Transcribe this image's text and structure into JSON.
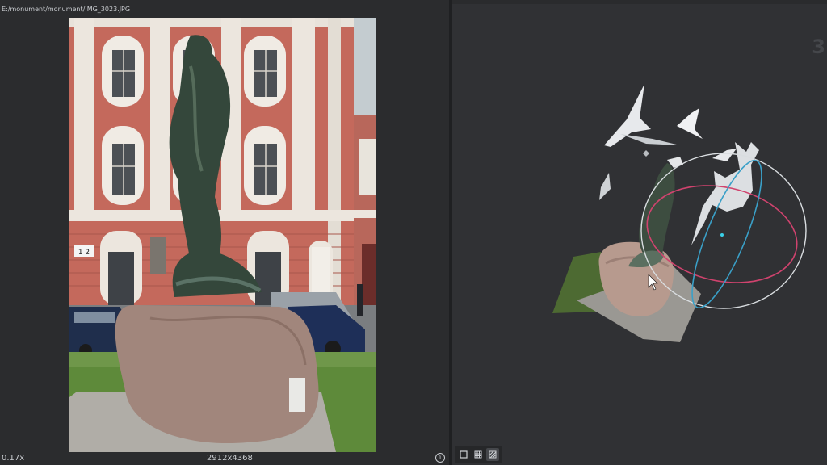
{
  "image_viewer": {
    "file_path": "E:/monument/monument/IMG_3023.JPG",
    "zoom": "0.17x",
    "resolution": "2912x4368",
    "info_icon": "info-icon"
  },
  "photo": {
    "building_number": "1 2"
  },
  "viewport_3d": {
    "corner_label": "3",
    "toolbar": [
      {
        "icon": "solid-view-icon"
      },
      {
        "icon": "grid-view-icon"
      },
      {
        "icon": "textured-view-icon"
      }
    ]
  },
  "colors": {
    "background": "#2f3033",
    "panel": "#2b2c2e",
    "gizmo_red": "#d0436e",
    "gizmo_cyan": "#3aa0c8",
    "gizmo_white": "#d9dde0"
  }
}
